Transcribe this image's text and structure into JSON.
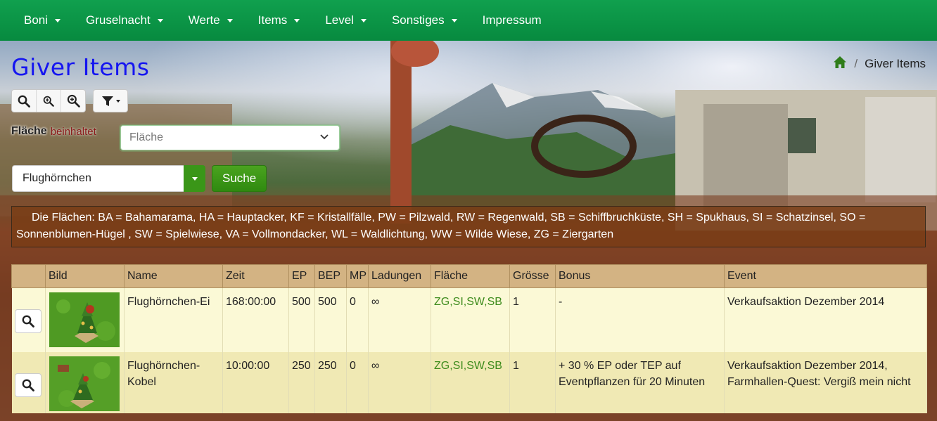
{
  "nav": {
    "items": [
      {
        "label": "Boni",
        "dropdown": true
      },
      {
        "label": "Gruselnacht",
        "dropdown": true
      },
      {
        "label": "Werte",
        "dropdown": true
      },
      {
        "label": "Items",
        "dropdown": true
      },
      {
        "label": "Level",
        "dropdown": true
      },
      {
        "label": "Sonstiges",
        "dropdown": true
      },
      {
        "label": "Impressum",
        "dropdown": false
      }
    ]
  },
  "page": {
    "title": "Giver Items",
    "breadcrumb": {
      "home_icon": "home-icon",
      "separator": "/",
      "current": "Giver Items"
    }
  },
  "toolbar": {
    "icons": [
      "search-icon",
      "zoom-out-icon",
      "zoom-in-icon",
      "filter-icon"
    ]
  },
  "filter": {
    "label": "Fläche",
    "operator": "beinhaltet",
    "placeholder": "Fläche"
  },
  "search": {
    "value": "Flughörnchen",
    "button_label": "Suche"
  },
  "legend": {
    "text": "Die Flächen: BA = Bahamarama, HA = Hauptacker, KF = Kristallfälle, PW = Pilzwald, RW = Regenwald, SB = Schiffbruchküste, SH = Spukhaus, SI = Schatzinsel, SO = Sonnenblumen-Hügel , SW = Spielwiese, VA = Vollmondacker, WL = Waldlichtung, WW = Wilde Wiese, ZG = Ziergarten"
  },
  "table": {
    "columns": [
      "",
      "Bild",
      "Name",
      "Zeit",
      "EP",
      "BEP",
      "MP",
      "Ladungen",
      "Fläche",
      "Grösse",
      "Bonus",
      "Event"
    ],
    "rows": [
      {
        "name": "Flughörnchen-Ei",
        "zeit": "168:00:00",
        "ep": "500",
        "bep": "500",
        "mp": "0",
        "ladungen": "∞",
        "flaeche": "ZG,SI,SW,SB",
        "groesse": "1",
        "bonus": "-",
        "event": "Verkaufsaktion Dezember 2014"
      },
      {
        "name": "Flughörnchen-Kobel",
        "zeit": "10:00:00",
        "ep": "250",
        "bep": "250",
        "mp": "0",
        "ladungen": "∞",
        "flaeche": "ZG,SI,SW,SB",
        "groesse": "1",
        "bonus": "+ 30 % EP oder TEP auf Eventpflanzen für 20 Minuten",
        "event": "Verkaufsaktion Dezember 2014, Farmhallen-Quest: Vergiß mein nicht"
      }
    ]
  },
  "colors": {
    "nav_bg": "#078a3f",
    "title": "#1515f0",
    "button_green": "#3a9618",
    "table_header": "#d3b383",
    "row_odd": "#fbf9d6",
    "row_even": "#f0e9b4",
    "flaeche_text": "#3d8b1c"
  }
}
